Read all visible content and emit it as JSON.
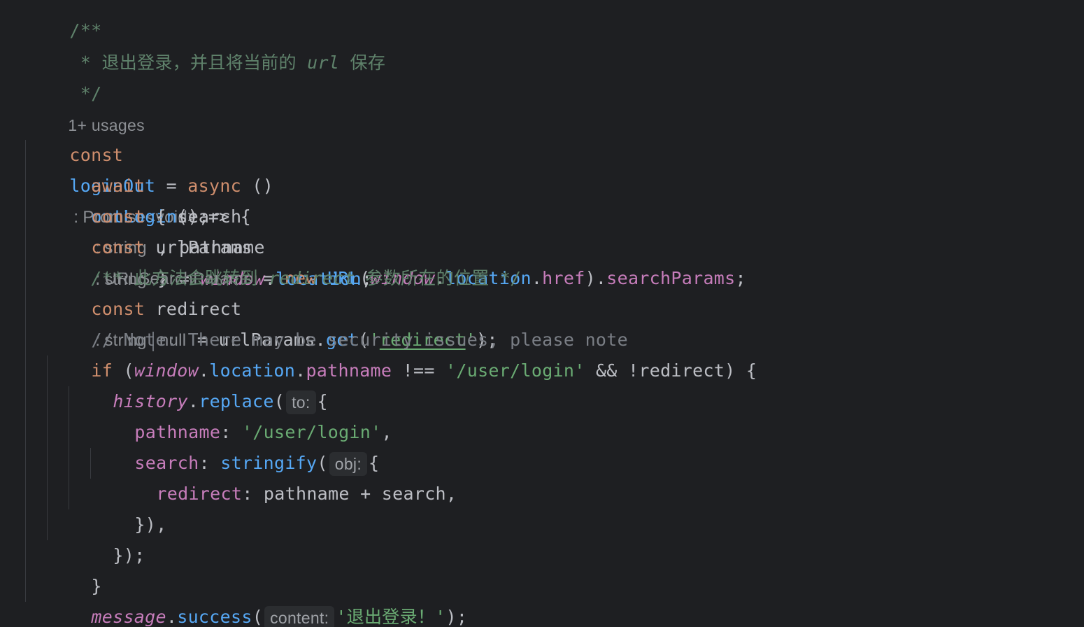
{
  "editor": {
    "lines": {
      "l0": {
        "t": "/**"
      },
      "l1": {
        "star": " * ",
        "cn1": "退出登录，并且将当前的 ",
        "url": "url",
        "cn2": " 保存"
      },
      "l2": {
        "t": " */"
      },
      "l3": {
        "usages": "1+ usages"
      },
      "l4": {
        "const": "const",
        "name": "loginOut",
        "eq": " = ",
        "async": "async",
        "parens": " ()",
        "hint": "Promise<void>",
        "arrow": " => {"
      },
      "l5": {
        "await": "await",
        "fn": "outLogin",
        "rest": "();"
      },
      "l6": {
        "const": "const",
        "open": " { ",
        "search": "search",
        "hint1": "string",
        "comma": " , ",
        "pathname": "pathname",
        "hint2": "string",
        "close": " } = ",
        "window": "window",
        "dot": ".",
        "location": "location",
        "semi": ";"
      },
      "l7": {
        "const": "const",
        "name": " urlParams",
        "hint": "URLSearchParams",
        "eq": " = ",
        "new": "new",
        "sp": " ",
        "cls": "URL",
        "op": "(",
        "window": "window",
        "dot1": ".",
        "location": "location",
        "dot2": ".",
        "href": "href",
        "cp": ").",
        "searchParams": "searchParams",
        "semi": ";"
      },
      "l8": {
        "start": "/** ",
        "cn1": "此方法会跳转到 ",
        "redirect": "redirect",
        "cn2": " 参数所在的位置 ",
        "end": "*/"
      },
      "l9": {
        "const": "const",
        "name": " redirect",
        "hint1": "string",
        "hint2": "null",
        "eq": " = urlParams.",
        "get": "get",
        "op": "(",
        "q1": "'",
        "str": "redirect",
        "q2": "'",
        "end": ");"
      },
      "l10": {
        "t": "// Note: There may be security issues, please note"
      },
      "l11": {
        "if": "if",
        "op": " (",
        "window": "window",
        "dot1": ".",
        "location": "location",
        "dot2": ".",
        "pathname": "pathname",
        "neq": " !== ",
        "str": "'/user/login'",
        "rest": " && !redirect) {"
      },
      "l12": {
        "history": "history",
        "dot": ".",
        "replace": "replace",
        "op": "(",
        "hint": "to:",
        "brace": "{"
      },
      "l13": {
        "key": "pathname",
        "colon": ": ",
        "str": "'/user/login'",
        "comma": ","
      },
      "l14": {
        "key": "search",
        "colon": ": ",
        "fn": "stringify",
        "op": "(",
        "hint": "obj:",
        "brace": "{"
      },
      "l15": {
        "key": "redirect",
        "rest": ": pathname + search,"
      },
      "l16": {
        "t": "}),"
      },
      "l17": {
        "t": "});"
      },
      "l18": {
        "t": "}"
      },
      "l19": {
        "message": "message",
        "dot": ".",
        "success": "success",
        "op": "(",
        "hint": "content:",
        "str": "'退出登录！'",
        "end": ");"
      },
      "l20": {
        "t": "};"
      }
    }
  }
}
